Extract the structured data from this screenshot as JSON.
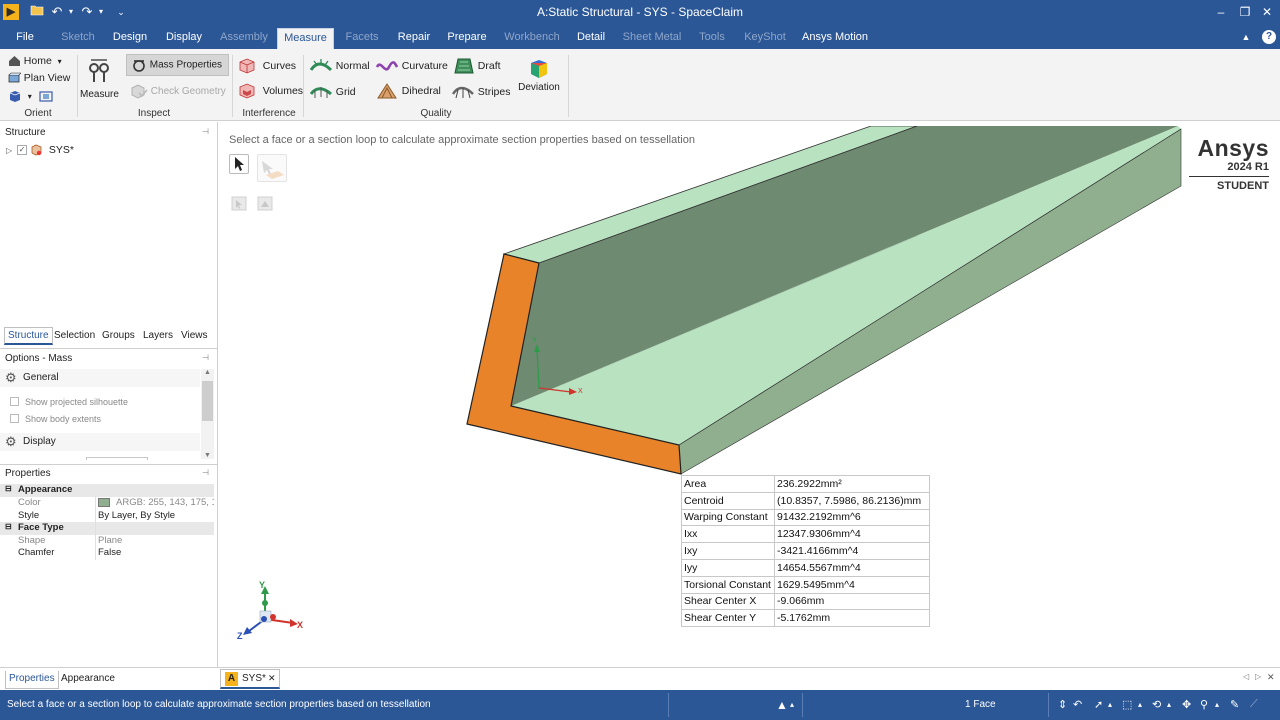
{
  "window": {
    "title": "A:Static Structural - SYS - SpaceClaim",
    "minimize": "–",
    "restore": "❐",
    "close": "✕"
  },
  "quick_access": {
    "undo": "↶",
    "redo": "↷",
    "more": "⌄"
  },
  "tabs": [
    {
      "label": "File",
      "state": "normal"
    },
    {
      "label": "Sketch",
      "state": "disabled"
    },
    {
      "label": "Design",
      "state": "normal"
    },
    {
      "label": "Display",
      "state": "normal"
    },
    {
      "label": "Assembly",
      "state": "disabled"
    },
    {
      "label": "Measure",
      "state": "active"
    },
    {
      "label": "Facets",
      "state": "disabled"
    },
    {
      "label": "Repair",
      "state": "normal"
    },
    {
      "label": "Prepare",
      "state": "normal"
    },
    {
      "label": "Workbench",
      "state": "disabled"
    },
    {
      "label": "Detail",
      "state": "normal"
    },
    {
      "label": "Sheet Metal",
      "state": "disabled"
    },
    {
      "label": "Tools",
      "state": "disabled"
    },
    {
      "label": "KeyShot",
      "state": "disabled"
    },
    {
      "label": "Ansys Motion",
      "state": "normal"
    }
  ],
  "ribbon": {
    "orient": {
      "home": "Home",
      "plan_view": "Plan View",
      "label": "Orient"
    },
    "inspect": {
      "measure": "Measure",
      "mass_properties": "Mass Properties",
      "check_geometry": "Check Geometry",
      "label": "Inspect"
    },
    "interference": {
      "curves": "Curves",
      "volumes": "Volumes",
      "label": "Interference"
    },
    "quality": {
      "normal": "Normal",
      "grid": "Grid",
      "curvature": "Curvature",
      "dihedral": "Dihedral",
      "draft": "Draft",
      "stripes": "Stripes",
      "deviation": "Deviation",
      "label": "Quality"
    }
  },
  "structure": {
    "title": "Structure",
    "root_item": "SYS*"
  },
  "panel_tabs": [
    "Structure",
    "Selection",
    "Groups",
    "Layers",
    "Views"
  ],
  "options": {
    "title": "Options - Mass",
    "general": "General",
    "show_silhouette": "Show projected silhouette",
    "show_extents": "Show body extents",
    "display": "Display"
  },
  "properties": {
    "title": "Properties",
    "appearance_group": "Appearance",
    "color_label": "Color",
    "color_value": "ARGB: 255, 143, 175, 1",
    "color_swatch": "#8faf8f",
    "style_label": "Style",
    "style_value": "By Layer, By Style",
    "face_type_group": "Face Type",
    "shape_label": "Shape",
    "shape_value": "Plane",
    "chamfer_label": "Chamfer",
    "chamfer_value": "False"
  },
  "bottom_panel_tabs": [
    "Properties",
    "Appearance"
  ],
  "viewport": {
    "hint": "Select a face or a section loop to calculate approximate section properties based on tessellation",
    "brand_name": "Ansys",
    "brand_version": "2024 R1",
    "brand_edition": "STUDENT",
    "axis_y": "Y",
    "axis_x": "X",
    "axis_z": "Z",
    "local_y": "Y",
    "local_x": "X",
    "face_color": "#b8e2c0",
    "face_dark": "#6e8a70",
    "section_color": "#e8832a"
  },
  "section_properties": [
    {
      "label": "Area",
      "value": "236.2922mm²"
    },
    {
      "label": "Centroid",
      "value": "(10.8357, 7.5986, 86.2136)mm"
    },
    {
      "label": "Warping Constant",
      "value": "91432.2192mm^6"
    },
    {
      "label": "Ixx",
      "value": "12347.9306mm^4"
    },
    {
      "label": "Ixy",
      "value": "-3421.4166mm^4"
    },
    {
      "label": "Iyy",
      "value": "14654.5567mm^4"
    },
    {
      "label": "Torsional Constant",
      "value": "1629.5495mm^4"
    },
    {
      "label": "Shear Center X",
      "value": "-9.066mm"
    },
    {
      "label": "Shear Center Y",
      "value": "-5.1762mm"
    }
  ],
  "doc_tab": {
    "label": "SYS*",
    "close": "✕"
  },
  "status": {
    "message": "Select a face or a section loop to calculate approximate section properties based on tessellation",
    "selection": "1 Face"
  }
}
